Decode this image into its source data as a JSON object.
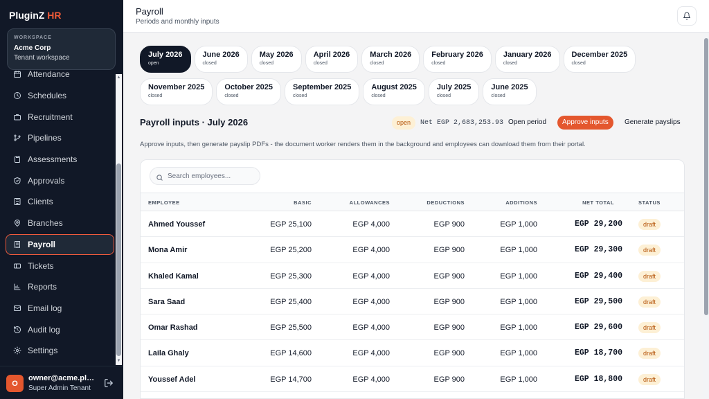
{
  "brand": {
    "name_main": "PluginZ",
    "name_accent": "HR"
  },
  "workspace": {
    "tag": "WORKSPACE",
    "name": "Acme Corp",
    "subtitle": "Tenant workspace"
  },
  "sidebar": {
    "items": [
      {
        "label": "Attendance",
        "icon": "calendar-icon",
        "active": false
      },
      {
        "label": "Schedules",
        "icon": "clock-icon",
        "active": false
      },
      {
        "label": "Recruitment",
        "icon": "briefcase-icon",
        "active": false
      },
      {
        "label": "Pipelines",
        "icon": "branch-icon",
        "active": false
      },
      {
        "label": "Assessments",
        "icon": "clipboard-icon",
        "active": false
      },
      {
        "label": "Approvals",
        "icon": "shield-check-icon",
        "active": false
      },
      {
        "label": "Clients",
        "icon": "building-icon",
        "active": false
      },
      {
        "label": "Branches",
        "icon": "map-pin-icon",
        "active": false
      },
      {
        "label": "Payroll",
        "icon": "receipt-icon",
        "active": true
      },
      {
        "label": "Tickets",
        "icon": "ticket-icon",
        "active": false
      },
      {
        "label": "Reports",
        "icon": "bar-chart-icon",
        "active": false
      },
      {
        "label": "Email log",
        "icon": "mail-icon",
        "active": false
      },
      {
        "label": "Audit log",
        "icon": "history-icon",
        "active": false
      },
      {
        "label": "Settings",
        "icon": "gear-icon",
        "active": false
      }
    ]
  },
  "user": {
    "initial": "O",
    "email": "owner@acme.pluginzhr",
    "role": "Super Admin Tenant"
  },
  "header": {
    "title": "Payroll",
    "subtitle": "Periods and monthly inputs"
  },
  "periods": {
    "row1": [
      {
        "month": "July 2026",
        "state": "open",
        "active": true
      },
      {
        "month": "June 2026",
        "state": "closed"
      },
      {
        "month": "May 2026",
        "state": "closed"
      },
      {
        "month": "April 2026",
        "state": "closed"
      },
      {
        "month": "March 2026",
        "state": "closed"
      },
      {
        "month": "February 2026",
        "state": "closed"
      },
      {
        "month": "January 2026",
        "state": "closed"
      },
      {
        "month": "December 2025",
        "state": "closed"
      }
    ],
    "row2": [
      {
        "month": "November 2025",
        "state": "closed"
      },
      {
        "month": "October 2025",
        "state": "closed"
      },
      {
        "month": "September 2025",
        "state": "closed"
      },
      {
        "month": "August 2025",
        "state": "closed"
      },
      {
        "month": "July 2025",
        "state": "closed"
      },
      {
        "month": "June 2025",
        "state": "closed"
      }
    ]
  },
  "inputs": {
    "title": "Payroll inputs · July 2026",
    "status_badge": "open",
    "net_total": "Net EGP 2,683,253.93",
    "open_period_label": "Open period",
    "approve_label": "Approve inputs",
    "generate_label": "Generate payslips",
    "help_text": "Approve inputs, then generate payslip PDFs - the document worker renders them in the background and employees can download them from their portal."
  },
  "search": {
    "placeholder": "Search employees..."
  },
  "table": {
    "columns": [
      "EMPLOYEE",
      "BASIC",
      "ALLOWANCES",
      "DEDUCTIONS",
      "ADDITIONS",
      "NET TOTAL",
      "STATUS"
    ],
    "rows": [
      {
        "employee": "Ahmed Youssef",
        "basic": "EGP 25,100",
        "allowances": "EGP 4,000",
        "deductions": "EGP 900",
        "additions": "EGP 1,000",
        "net": "EGP 29,200",
        "status": "draft"
      },
      {
        "employee": "Mona Amir",
        "basic": "EGP 25,200",
        "allowances": "EGP 4,000",
        "deductions": "EGP 900",
        "additions": "EGP 1,000",
        "net": "EGP 29,300",
        "status": "draft"
      },
      {
        "employee": "Khaled Kamal",
        "basic": "EGP 25,300",
        "allowances": "EGP 4,000",
        "deductions": "EGP 900",
        "additions": "EGP 1,000",
        "net": "EGP 29,400",
        "status": "draft"
      },
      {
        "employee": "Sara Saad",
        "basic": "EGP 25,400",
        "allowances": "EGP 4,000",
        "deductions": "EGP 900",
        "additions": "EGP 1,000",
        "net": "EGP 29,500",
        "status": "draft"
      },
      {
        "employee": "Omar Rashad",
        "basic": "EGP 25,500",
        "allowances": "EGP 4,000",
        "deductions": "EGP 900",
        "additions": "EGP 1,000",
        "net": "EGP 29,600",
        "status": "draft"
      },
      {
        "employee": "Laila Ghaly",
        "basic": "EGP 14,600",
        "allowances": "EGP 4,000",
        "deductions": "EGP 900",
        "additions": "EGP 1,000",
        "net": "EGP 18,700",
        "status": "draft"
      },
      {
        "employee": "Youssef Adel",
        "basic": "EGP 14,700",
        "allowances": "EGP 4,000",
        "deductions": "EGP 900",
        "additions": "EGP 1,000",
        "net": "EGP 18,800",
        "status": "draft"
      }
    ]
  },
  "colors": {
    "accent": "#e4572e",
    "sidebar_bg": "#111827",
    "draft_badge_bg": "#fdf0d5",
    "draft_badge_text": "#b45309"
  }
}
